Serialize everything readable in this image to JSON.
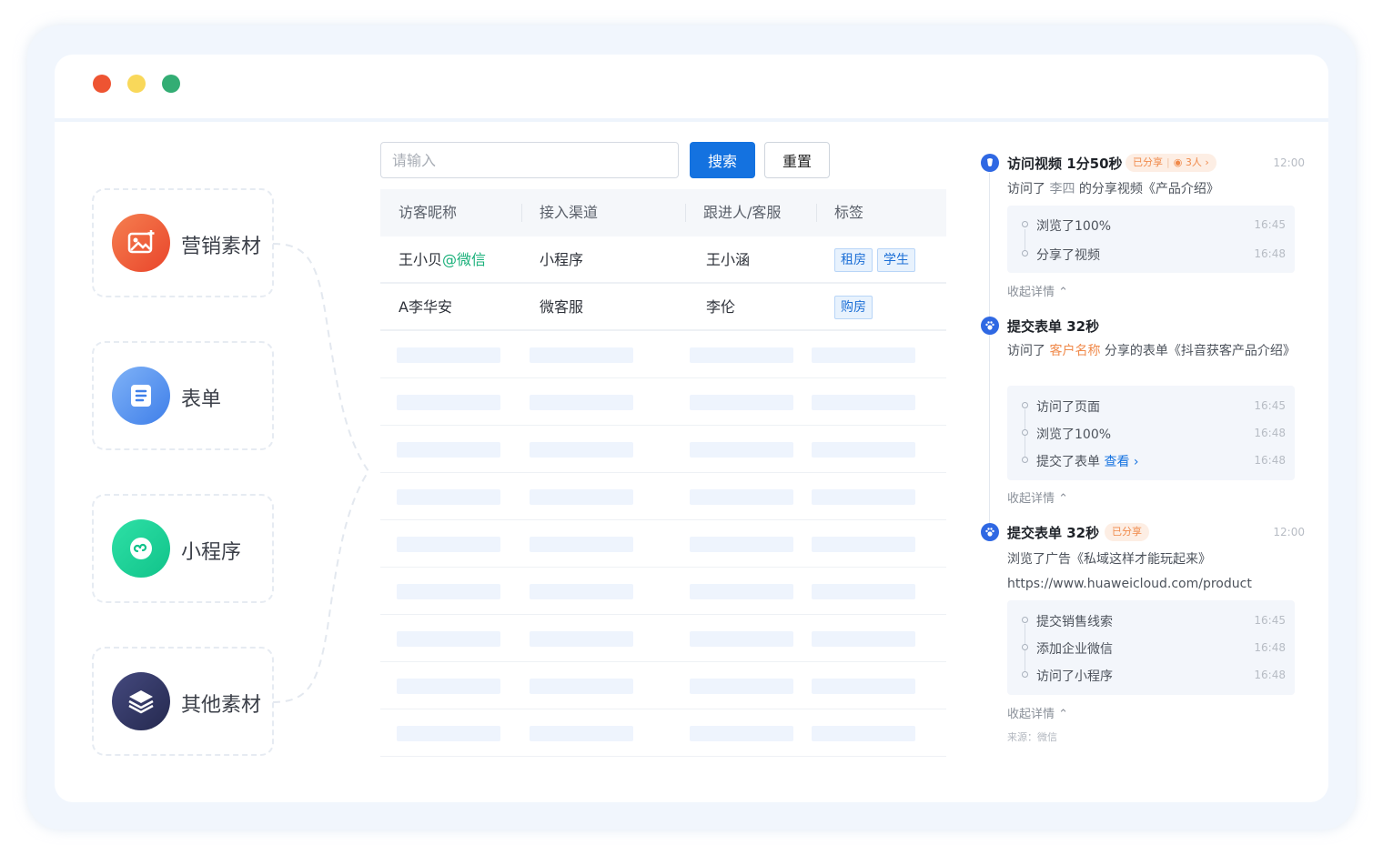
{
  "window": {
    "controls": [
      "close",
      "minimize",
      "maximize"
    ]
  },
  "sources": [
    {
      "label": "营销素材",
      "icon": "image-icon",
      "color": "#ee5a32"
    },
    {
      "label": "表单",
      "icon": "form-icon",
      "color": "#4b8cf0"
    },
    {
      "label": "小程序",
      "icon": "mini-program-icon",
      "color": "#1ccb92"
    },
    {
      "label": "其他素材",
      "icon": "layers-icon",
      "color": "#34386a"
    }
  ],
  "search": {
    "placeholder": "请输入",
    "search_label": "搜索",
    "reset_label": "重置"
  },
  "table": {
    "headers": [
      "访客昵称",
      "接入渠道",
      "跟进人/客服",
      "标签"
    ],
    "rows": [
      {
        "name": "王小贝",
        "name_suffix": "@微信",
        "channel": "小程序",
        "follower": "王小涵",
        "tags": [
          "租房",
          "学生"
        ]
      },
      {
        "name": "A李华安",
        "name_suffix": "",
        "channel": "微客服",
        "follower": "李伦",
        "tags": [
          "购房"
        ]
      }
    ]
  },
  "timeline": [
    {
      "title": "访问视频 1分50秒",
      "badge_shared": "已分享",
      "badge_views": "3人",
      "time": "12:00",
      "desc_prefix": "访问了",
      "desc_person": "李四",
      "desc_suffix": "的分享视频《产品介绍》",
      "items": [
        {
          "text": "浏览了100%",
          "time": "16:45"
        },
        {
          "text": "分享了视频",
          "time": "16:48"
        }
      ],
      "collapse": "收起详情"
    },
    {
      "title": "提交表单 32秒",
      "desc_prefix": "访问了",
      "desc_person": "客户名称",
      "desc_suffix": "分享的表单《抖音获客产品介绍》",
      "items": [
        {
          "text": "访问了页面",
          "time": "16:45"
        },
        {
          "text": "浏览了100%",
          "time": "16:48"
        },
        {
          "text": "提交了表单",
          "link": "查看",
          "time": "16:48"
        }
      ],
      "collapse": "收起详情"
    },
    {
      "title": "提交表单 32秒",
      "badge_shared": "已分享",
      "time": "12:00",
      "desc": "浏览了广告《私域这样才能玩起来》",
      "url": "https://www.huaweicloud.com/product",
      "items": [
        {
          "text": "提交销售线索",
          "time": "16:45"
        },
        {
          "text": "添加企业微信",
          "time": "16:48"
        },
        {
          "text": "访问了小程序",
          "time": "16:48"
        }
      ],
      "collapse": "收起详情",
      "source": "来源：微信"
    }
  ],
  "colors": {
    "primary": "#1472e0",
    "accent_orange": "#f08a4b",
    "wechat_green": "#19b07a"
  }
}
